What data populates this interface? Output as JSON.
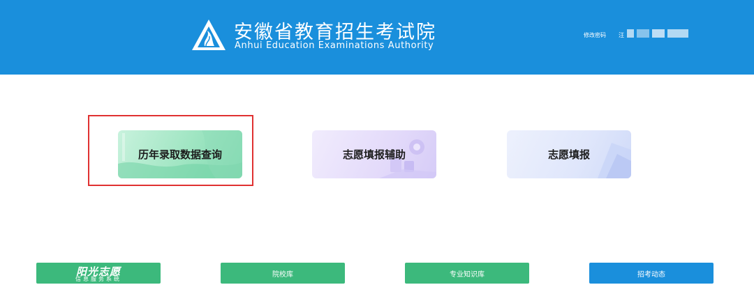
{
  "header": {
    "org_name_cn": "安徽省教育招生考试院",
    "org_name_en": "Anhui Education Examinations Authority",
    "change_password": "修改密码",
    "user_name": "汪"
  },
  "cards": [
    {
      "label": "历年录取数据查询"
    },
    {
      "label": "志愿填报辅助"
    },
    {
      "label": "志愿填报"
    }
  ],
  "bottom_links": {
    "sunshine_title": "阳光志愿",
    "sunshine_subtitle": "信息服务系统",
    "college_db": "院校库",
    "major_db": "专业知识库",
    "admission_news": "招考动态"
  },
  "colors": {
    "header_bg": "#1a8fdc",
    "green_button": "#3cb97c",
    "blue_button": "#1a8fdc",
    "highlight_border": "#e03131"
  }
}
